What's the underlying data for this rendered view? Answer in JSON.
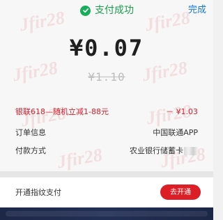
{
  "header": {
    "title": "支付成功",
    "done_label": "完成",
    "success_icon": "check-circle-icon"
  },
  "payment": {
    "amount": "¥0.07",
    "original_amount": "¥1.10"
  },
  "details": {
    "promotion": {
      "label": "银联618—随机立减1-88元",
      "value": "－ ¥1.03"
    },
    "order_info": {
      "label": "订单信息",
      "value": "中国联通APP"
    },
    "payment_method": {
      "label": "付款方式",
      "value": "农业银行储蓄卡"
    }
  },
  "fingerprint": {
    "label": "开通指纹支付",
    "button_label": "去开通"
  },
  "colors": {
    "success_green": "#17ad5a",
    "accent_red": "#dc1f27",
    "done_blue": "#1677d9"
  }
}
